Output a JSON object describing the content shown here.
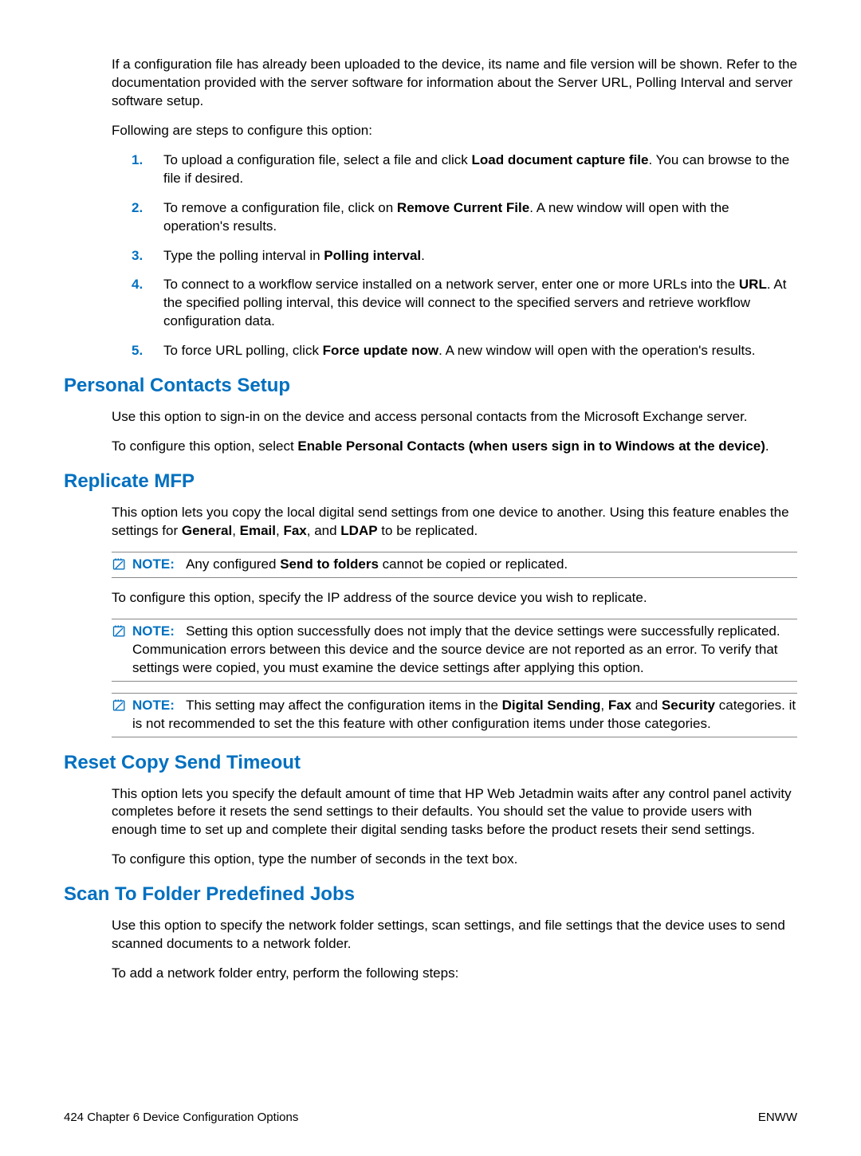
{
  "intro": {
    "p1_pre": "If a configuration file has already been uploaded to the device, its name and file version will be shown. Refer to the documentation provided with the server software for information about the Server URL, Polling Interval and server software setup.",
    "p2": "Following are steps to configure this option:"
  },
  "steps": {
    "s1": {
      "num": "1.",
      "pre": "To upload a configuration file, select a file and click ",
      "bold": "Load document capture file",
      "post": ". You can browse to the file if desired."
    },
    "s2": {
      "num": "2.",
      "pre": "To remove a configuration file, click on ",
      "bold": "Remove Current File",
      "post": ". A new window will open with the operation's results."
    },
    "s3": {
      "num": "3.",
      "pre": "Type the polling interval in ",
      "bold": "Polling interval",
      "post": "."
    },
    "s4": {
      "num": "4.",
      "pre": "To connect to a workflow service installed on a network server, enter one or more URLs into the ",
      "bold": "URL",
      "post": ". At the specified polling interval, this device will connect to the specified servers and retrieve workflow configuration data."
    },
    "s5": {
      "num": "5.",
      "pre": "To force URL polling, click ",
      "bold": "Force update now",
      "post": ". A new window will open with the operation's results."
    }
  },
  "personal": {
    "title": "Personal Contacts Setup",
    "p1": "Use this option to sign-in on the device and access personal contacts from the Microsoft Exchange server.",
    "p2_pre": "To configure this option, select ",
    "p2_bold": "Enable Personal Contacts (when users sign in to Windows at the device)",
    "p2_post": "."
  },
  "replicate": {
    "title": "Replicate MFP",
    "p1_pre": "This option lets you copy the local digital send settings from one device to another. Using this feature enables the settings for ",
    "b_general": "General",
    "c1": ", ",
    "b_email": "Email",
    "c2": ", ",
    "b_fax": "Fax",
    "c3": ", and ",
    "b_ldap": "LDAP",
    "p1_post": " to be replicated.",
    "note1_label": "NOTE:",
    "note1_pre": "Any configured ",
    "note1_bold": "Send to folders",
    "note1_post": " cannot be copied or replicated.",
    "p2": "To configure this option, specify the IP address of the source device you wish to replicate.",
    "note2_label": "NOTE:",
    "note2_text": "Setting this option successfully does not imply that the device settings were successfully replicated. Communication errors between this device and the source device are not reported as an error. To verify that settings were copied, you must examine the device settings after applying this option.",
    "note3_label": "NOTE:",
    "note3_pre": "This setting may affect the configuration items in the ",
    "note3_b1": "Digital Sending",
    "note3_mid1": ", ",
    "note3_b2": "Fax",
    "note3_mid2": " and ",
    "note3_b3": "Security",
    "note3_post": " categories. it is not recommended to set the this feature with other configuration items under those categories."
  },
  "reset": {
    "title": "Reset Copy Send Timeout",
    "p1": "This option lets you specify the default amount of time that HP Web Jetadmin waits after any control panel activity completes before it resets the send settings to their defaults. You should set the value to provide users with enough time to set up and complete their digital sending tasks before the product resets their send settings.",
    "p2": "To configure this option, type the number of seconds in the text box."
  },
  "scan": {
    "title": "Scan To Folder Predefined Jobs",
    "p1": "Use this option to specify the network folder settings, scan settings, and file settings that the device uses to send scanned documents to a network folder.",
    "p2": "To add a network folder entry, perform the following steps:"
  },
  "footer": {
    "left": "424   Chapter 6   Device Configuration Options",
    "right": "ENWW"
  }
}
